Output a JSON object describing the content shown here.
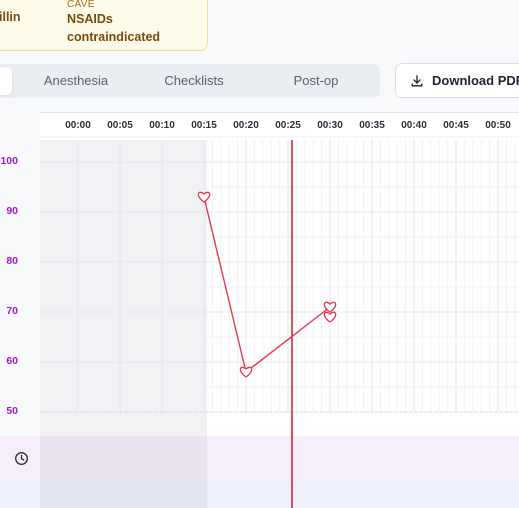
{
  "allergies": {
    "item": "illin",
    "cave_label": "CAVE",
    "cave_text": "NSAIDs contraindicated"
  },
  "tabs": [
    {
      "label": "Anesthesia"
    },
    {
      "label": "Checklists"
    },
    {
      "label": "Post-op"
    }
  ],
  "download": {
    "label": "Download PDF",
    "icon": "download-icon"
  },
  "chart": {
    "time_labels": [
      "00:00",
      "00:05",
      "00:10",
      "00:15",
      "00:20",
      "00:25",
      "00:30",
      "00:35",
      "00:40",
      "00:45",
      "00:50"
    ],
    "y_labels": [
      "100",
      "90",
      "80",
      "70",
      "60",
      "50"
    ],
    "current_time": "00:25",
    "time_icon": "clock-icon",
    "colors": {
      "series": "#e8384f",
      "y_axis": "#a21bd0",
      "now_line": "#d92632"
    }
  },
  "chart_data": {
    "type": "line",
    "ylim": [
      50,
      100
    ],
    "series": [
      {
        "x": [
          "00:15",
          "00:20",
          "00:30"
        ],
        "values": [
          93,
          58,
          71
        ]
      }
    ],
    "extra_points": [
      {
        "x": "00:30",
        "value": 69
      }
    ]
  }
}
